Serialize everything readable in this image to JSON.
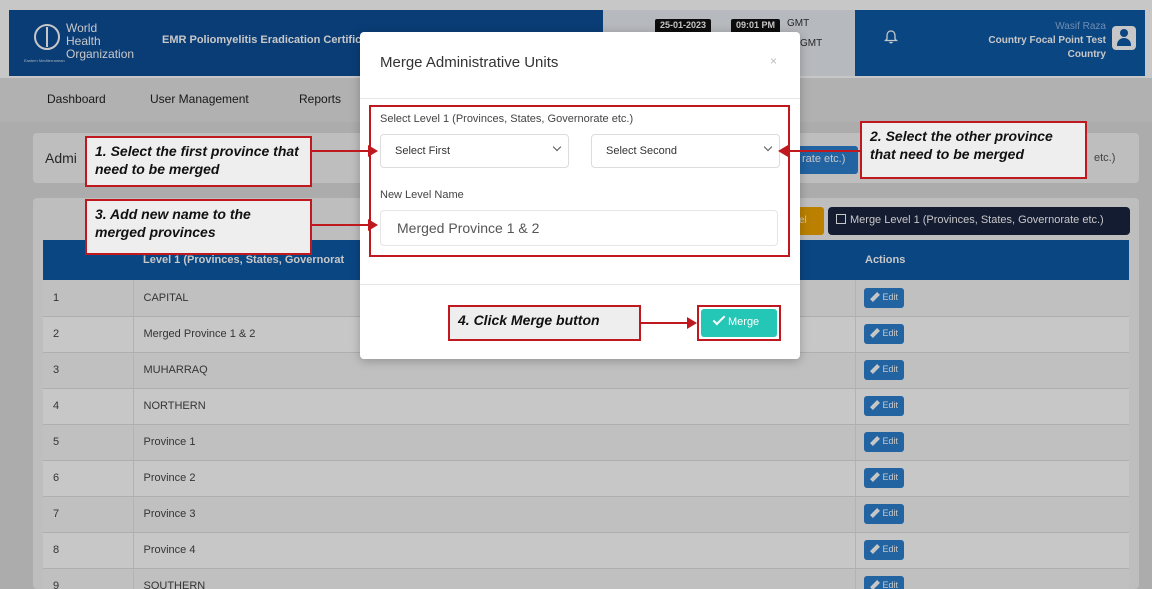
{
  "header": {
    "org_name": "World Health Organization",
    "org_region": "Eastern Mediterranean",
    "app_title": "EMR Poliomyelitis Eradication Certific",
    "date": "25-01-2023",
    "time": "09:01 PM",
    "gmt_1": "GMT",
    "gmt_2": "GMT",
    "user_name": "Wasif Raza",
    "user_role": "Country Focal Point Test",
    "user_scope": "Country"
  },
  "nav": {
    "items": [
      "Dashboard",
      "User Management",
      "Reports"
    ]
  },
  "page": {
    "card_title": "Admi",
    "tab_blue_text": "rate etc.)",
    "tab_gray_text": "etc.)",
    "btn_yellow_text": "vel",
    "btn_merge_level": "Merge Level 1 (Provinces, States, Governorate etc.)"
  },
  "table": {
    "headers": [
      "",
      "Level 1 (Provinces, States, Governorat",
      "Actions"
    ],
    "edit_label": "Edit",
    "rows": [
      {
        "num": "1",
        "name": "CAPITAL"
      },
      {
        "num": "2",
        "name": "Merged Province 1 & 2"
      },
      {
        "num": "3",
        "name": "MUHARRAQ"
      },
      {
        "num": "4",
        "name": "NORTHERN"
      },
      {
        "num": "5",
        "name": "Province 1"
      },
      {
        "num": "6",
        "name": "Province 2"
      },
      {
        "num": "7",
        "name": "Province 3"
      },
      {
        "num": "8",
        "name": "Province 4"
      },
      {
        "num": "9",
        "name": "SOUTHERN"
      }
    ]
  },
  "modal": {
    "title": "Merge Administrative Units",
    "close": "×",
    "level_label": "Select Level 1 (Provinces, States, Governorate etc.)",
    "select_first": "Select First",
    "select_second": "Select Second",
    "new_name_label": "New Level Name",
    "new_name_value": "Merged Province 1 & 2",
    "merge_button": "Merge"
  },
  "callouts": {
    "step1": "1. Select the first province that need to be merged",
    "step2": "2. Select the other province that need to be merged",
    "step3": "3. Add new name to the merged provinces",
    "step4": "4. Click Merge button"
  },
  "colors": {
    "header_blue": "#0d5aa7",
    "accent_teal": "#24c6b6",
    "callout_red": "#c0181f",
    "edit_blue": "#2c7fd0"
  }
}
